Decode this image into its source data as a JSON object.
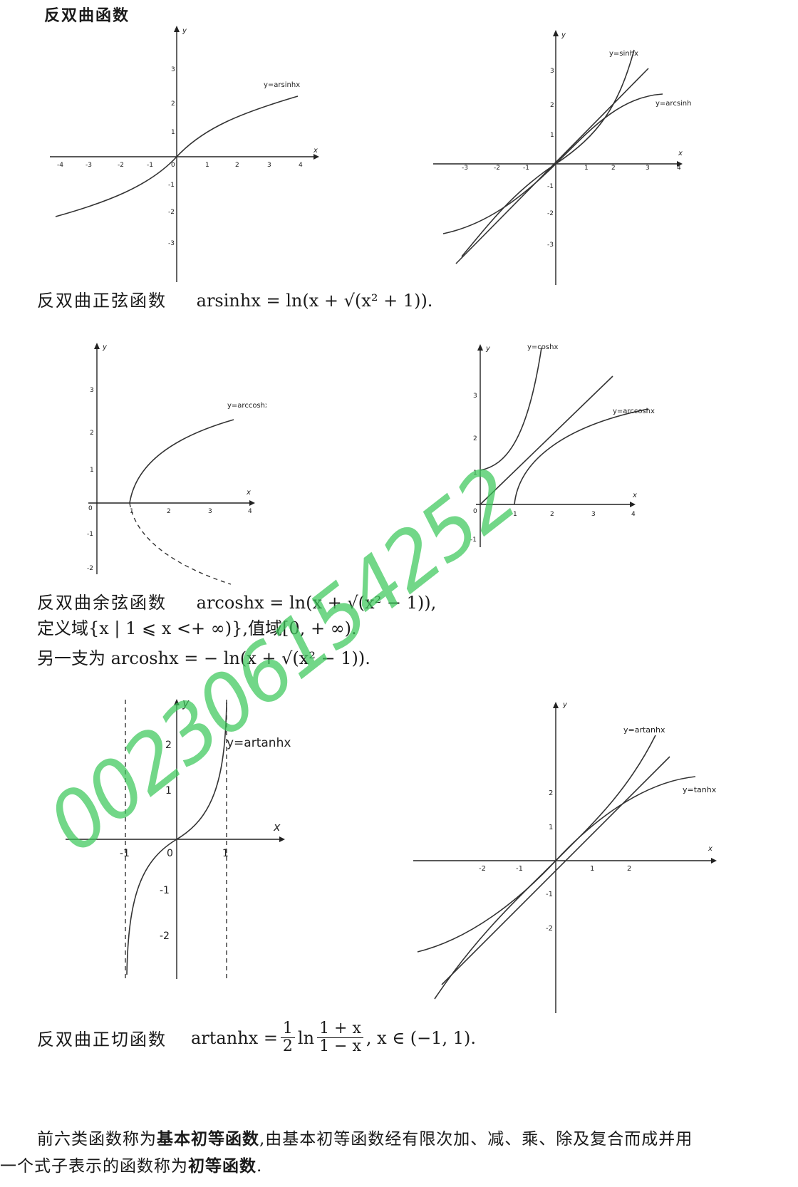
{
  "heading": "反双曲函数",
  "sections": {
    "arsinh": {
      "label": "反双曲正弦函数",
      "formula": "arsinhx = ln(x + √(x² + 1))."
    },
    "arcosh": {
      "label": "反双曲余弦函数",
      "formula": "arcoshx = ln(x + √(x² − 1)),",
      "domain_line": "定义域{x | 1 ⩽ x <+ ∞)},值域[0, + ∞).",
      "other_branch": "另一支为 arcoshx = − ln(x + √(x² − 1))."
    },
    "artanh": {
      "label": "反双曲正切函数",
      "formula_lhs": "artanhx =",
      "frac_outer_num": "1",
      "frac_outer_den": "2",
      "ln": "ln",
      "frac_inner_num": "1 + x",
      "frac_inner_den": "1 − x",
      "formula_tail": ", x ∈ (−1, 1)."
    }
  },
  "closing": {
    "line1_pre": "前六类函数称为",
    "term1": "基本初等函数",
    "line1_post": ",由基本初等函数经有限次加、减、乘、除及复合而成并用",
    "line2_pre": "一个式子表示的函数称为",
    "term2": "初等函数",
    "line2_post": "."
  },
  "watermark": "002306154252",
  "graphs": {
    "g1": {
      "curve_label": "y=arsinhx",
      "x_label": "x",
      "y_label": "y",
      "x_ticks": [
        "-4",
        "-3",
        "-2",
        "-1",
        "0",
        "1",
        "2",
        "3",
        "4"
      ],
      "y_ticks": [
        "-3",
        "-2",
        "-1",
        "1",
        "2",
        "3"
      ]
    },
    "g2": {
      "label_sinh": "y=sinhx",
      "label_arcsinh": "y=arcsinhx",
      "x_label": "x",
      "y_label": "y",
      "x_ticks": [
        "-3",
        "-2",
        "-1",
        "1",
        "2",
        "3",
        "4"
      ],
      "y_ticks": [
        "-3",
        "-2",
        "-1",
        "1",
        "2",
        "3"
      ]
    },
    "g3": {
      "curve_label": "y=arccoshx",
      "x_label": "x",
      "y_label": "y",
      "x_ticks": [
        "0",
        "1",
        "2",
        "3",
        "4"
      ],
      "y_ticks": [
        "-2",
        "-1",
        "1",
        "2",
        "3"
      ]
    },
    "g4": {
      "label_cosh": "y=coshx",
      "label_arccosh": "y=arccoshx",
      "x_label": "x",
      "y_label": "y",
      "x_ticks": [
        "0",
        "1",
        "2",
        "3",
        "4"
      ],
      "y_ticks": [
        "-1",
        "1",
        "2",
        "3"
      ]
    },
    "g5": {
      "curve_label": "y=artanhx",
      "x_label": "x",
      "y_label": "y",
      "x_ticks": [
        "-1",
        "0",
        "1"
      ],
      "y_ticks": [
        "-2",
        "-1",
        "1",
        "2"
      ]
    },
    "g6": {
      "label_artanh": "y=artanhx",
      "label_tanh": "y=tanhx",
      "x_label": "x",
      "y_label": "y",
      "x_ticks": [
        "-2",
        "-1",
        "1",
        "2"
      ],
      "y_ticks": [
        "-2",
        "-1",
        "1",
        "2"
      ]
    }
  }
}
